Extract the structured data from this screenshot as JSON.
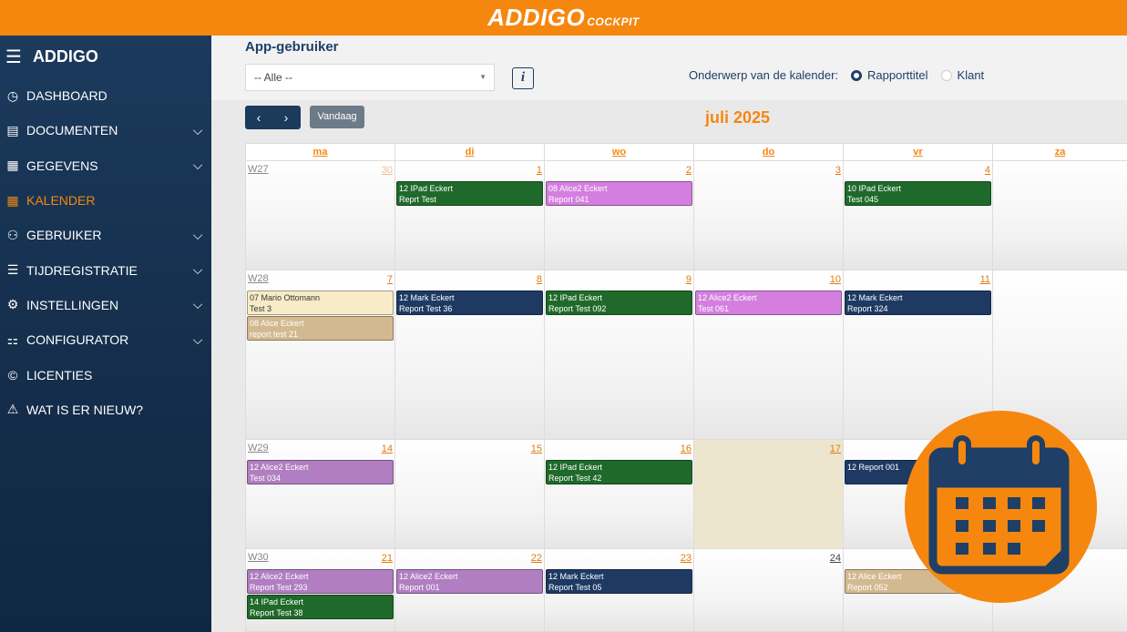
{
  "brand": {
    "name": "ADDIGO",
    "suffix": "COCKPIT"
  },
  "sidebar": {
    "title": "ADDIGO",
    "items": [
      {
        "label": "DASHBOARD",
        "icon": "dashboard-icon",
        "glyph": "◷",
        "expandable": false,
        "active": false
      },
      {
        "label": "DOCUMENTEN",
        "icon": "documents-icon",
        "glyph": "▤",
        "expandable": true,
        "active": false
      },
      {
        "label": "GEGEVENS",
        "icon": "data-edit-icon",
        "glyph": "▦",
        "expandable": true,
        "active": false
      },
      {
        "label": "KALENDER",
        "icon": "calendar-icon",
        "glyph": "▦",
        "expandable": false,
        "active": true
      },
      {
        "label": "GEBRUIKER",
        "icon": "users-icon",
        "glyph": "⚇",
        "expandable": true,
        "active": false
      },
      {
        "label": "TIJDREGISTRATIE",
        "icon": "list-icon",
        "glyph": "☰",
        "expandable": true,
        "active": false
      },
      {
        "label": "INSTELLINGEN",
        "icon": "gear-icon",
        "glyph": "⚙",
        "expandable": true,
        "active": false
      },
      {
        "label": "CONFIGURATOR",
        "icon": "configurator-icon",
        "glyph": "⚏",
        "expandable": true,
        "active": false
      },
      {
        "label": "LICENTIES",
        "icon": "copyright-icon",
        "glyph": "©",
        "expandable": false,
        "active": false
      },
      {
        "label": "WAT IS ER NIEUW?",
        "icon": "warning-icon",
        "glyph": "⚠",
        "expandable": false,
        "active": false
      }
    ]
  },
  "filter": {
    "app_user_label": "App-gebruiker",
    "select_value": "-- Alle --",
    "info_label": "i",
    "subject_label": "Onderwerp van de kalender:",
    "options": [
      {
        "label": "Rapporttitel",
        "selected": true
      },
      {
        "label": "Klant",
        "selected": false
      }
    ]
  },
  "nav": {
    "prev": "‹",
    "next": "›",
    "today": "Vandaag",
    "month": "juli 2025"
  },
  "calendar": {
    "days": [
      "ma",
      "di",
      "wo",
      "do",
      "vr",
      "za"
    ],
    "weeks": [
      {
        "label": "W27",
        "dates": [
          {
            "num": "30",
            "style": "dim",
            "events": []
          },
          {
            "num": "1",
            "events": [
              {
                "l1": "12 IPad Eckert",
                "l2": "Reprt Test",
                "color": "green"
              }
            ]
          },
          {
            "num": "2",
            "events": [
              {
                "l1": "08 Alice2 Eckert",
                "l2": "Report 041",
                "color": "pink"
              }
            ]
          },
          {
            "num": "3",
            "events": []
          },
          {
            "num": "4",
            "events": [
              {
                "l1": "10 IPad Eckert",
                "l2": "Test 045",
                "color": "green"
              }
            ]
          },
          {
            "num": "",
            "events": []
          }
        ]
      },
      {
        "label": "W28",
        "dates": [
          {
            "num": "7",
            "events": [
              {
                "l1": "07 Mario Ottomann",
                "l2": "Test 3",
                "color": "cream"
              },
              {
                "l1": "08 Alice Eckert",
                "l2": "report test 21",
                "color": "tan"
              }
            ]
          },
          {
            "num": "8",
            "events": [
              {
                "l1": "12 Mark Eckert",
                "l2": "Report Test 36",
                "color": "navy"
              }
            ]
          },
          {
            "num": "9",
            "events": [
              {
                "l1": "12 IPad Eckert",
                "l2": "Report Test 092",
                "color": "green"
              }
            ]
          },
          {
            "num": "10",
            "events": [
              {
                "l1": "12 Alice2 Eckert",
                "l2": "Test 061",
                "color": "pink"
              }
            ]
          },
          {
            "num": "11",
            "events": [
              {
                "l1": "12 Mark Eckert",
                "l2": "Report 324",
                "color": "navy"
              }
            ]
          },
          {
            "num": "",
            "events": []
          }
        ]
      },
      {
        "label": "W29",
        "dates": [
          {
            "num": "14",
            "events": [
              {
                "l1": "12 Alice2 Eckert",
                "l2": "Test 034",
                "color": "purple"
              }
            ]
          },
          {
            "num": "15",
            "events": []
          },
          {
            "num": "16",
            "events": [
              {
                "l1": "12 IPad Eckert",
                "l2": "Report Test 42",
                "color": "green"
              }
            ]
          },
          {
            "num": "17",
            "today": true,
            "events": []
          },
          {
            "num": "",
            "events": [
              {
                "l1": "12 Report 001",
                "l2": "",
                "color": "navy"
              }
            ]
          },
          {
            "num": "",
            "events": []
          }
        ]
      },
      {
        "label": "W30",
        "dates": [
          {
            "num": "21",
            "events": [
              {
                "l1": "12 Alice2 Eckert",
                "l2": "Report Test 293",
                "color": "purple"
              },
              {
                "l1": "14 IPad Eckert",
                "l2": "Report Test 38",
                "color": "green"
              }
            ]
          },
          {
            "num": "22",
            "events": [
              {
                "l1": "12 Alice2 Eckert",
                "l2": "Report 001",
                "color": "purple"
              }
            ]
          },
          {
            "num": "23",
            "events": [
              {
                "l1": "12 Mark Eckert",
                "l2": "Report Test 05",
                "color": "navy"
              }
            ]
          },
          {
            "num": "24",
            "style": "plain",
            "events": []
          },
          {
            "num": "",
            "events": [
              {
                "l1": "12 Alice Eckert",
                "l2": "Report 052",
                "color": "tan"
              }
            ]
          },
          {
            "num": "",
            "events": []
          }
        ]
      }
    ]
  },
  "overlay": {
    "icon": "calendar-icon",
    "color": "#f5870f",
    "icon_color": "#1f3f66"
  }
}
